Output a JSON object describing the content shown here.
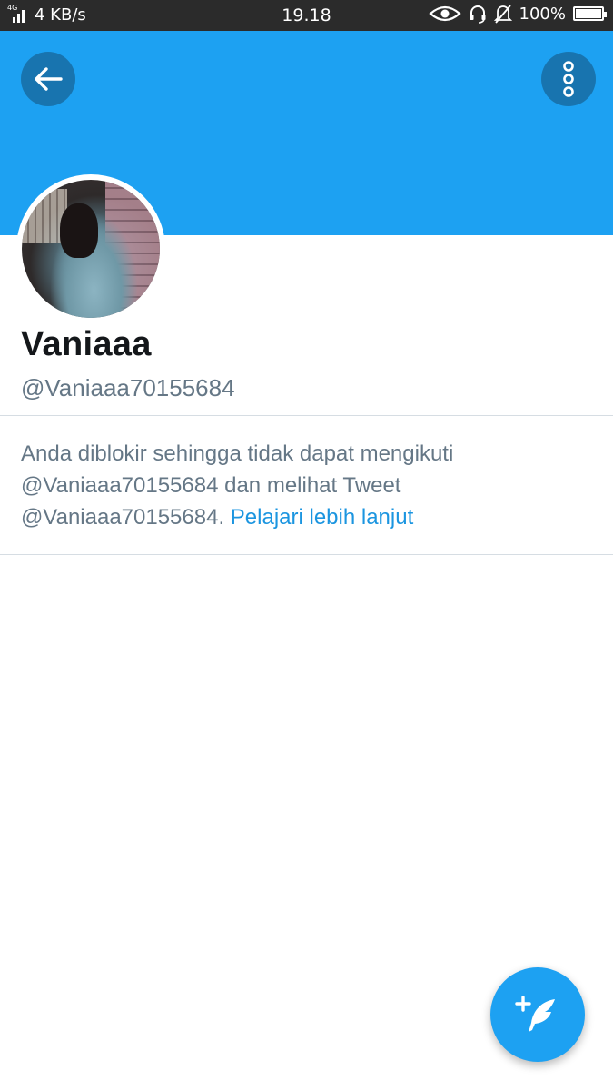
{
  "status_bar": {
    "network_type": "4G",
    "speed": "4 KB/s",
    "time": "19.18",
    "battery": "100%",
    "battery_level": 1.0
  },
  "header": {
    "back_icon": "arrow-left-icon",
    "more_icon": "vertical-dots-icon",
    "banner_color": "#1da1f2"
  },
  "profile": {
    "display_name": "Vaniaaa",
    "handle": "@Vaniaaa70155684"
  },
  "blocked_notice": {
    "message_line1": "Anda diblokir sehingga tidak dapat mengikuti",
    "message_line2": "@Vaniaaa70155684 dan melihat Tweet",
    "message_line3": "@Vaniaaa70155684.",
    "learn_more_link": "Pelajari lebih lanjut"
  },
  "fab": {
    "icon": "compose-tweet-icon",
    "color": "#1da1f2"
  }
}
